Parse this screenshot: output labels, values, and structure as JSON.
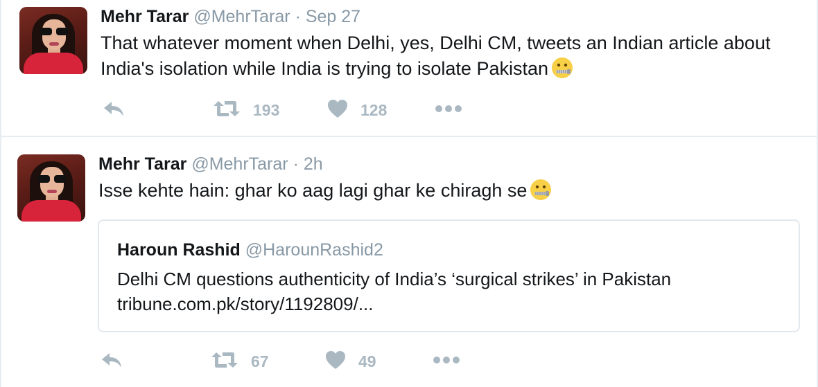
{
  "tweets": [
    {
      "author_name": "Mehr Tarar",
      "handle": "@MehrTarar",
      "separator": "·",
      "time": "Sep 27",
      "text_lines": [
        "That whatever moment when Delhi, yes, Delhi CM, tweets an Indian article about",
        "India's isolation while India is trying to isolate Pakistan"
      ],
      "emoji": "zipper-mouth-face",
      "retweets": "193",
      "likes": "128"
    },
    {
      "author_name": "Mehr Tarar",
      "handle": "@MehrTarar",
      "separator": "·",
      "time": "2h",
      "text_lines": [
        "Isse kehte hain: ghar ko aag lagi ghar ke chiragh se"
      ],
      "emoji": "zipper-mouth-face",
      "quote": {
        "author_name": "Haroun Rashid",
        "handle": "@HarounRashid2",
        "text": "Delhi CM questions authenticity of India’s ‘surgical strikes’ in Pakistan",
        "link": "tribune.com.pk/story/1192809/..."
      },
      "retweets": "67",
      "likes": "49"
    }
  ],
  "icons": {
    "reply": "reply-icon",
    "retweet": "retweet-icon",
    "like": "heart-icon",
    "more": "more-dots-icon"
  },
  "colors": {
    "text": "#14171a",
    "secondary": "#8899a6",
    "action": "#aab8c2",
    "border": "#e6ecf0"
  }
}
